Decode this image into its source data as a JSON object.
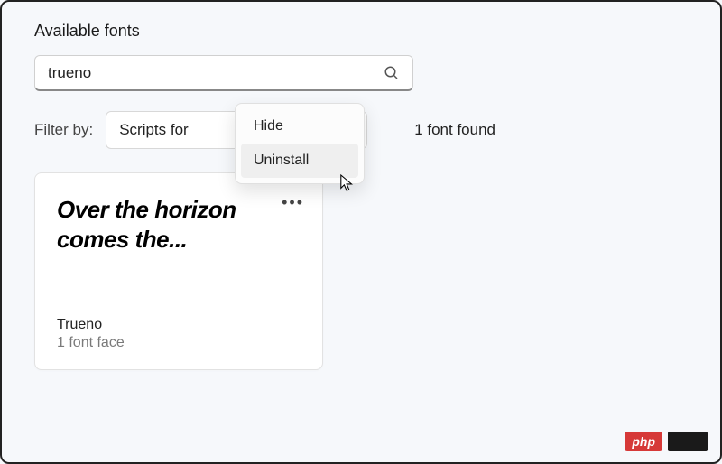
{
  "section_title": "Available fonts",
  "search": {
    "value": "trueno"
  },
  "filter": {
    "label": "Filter by:",
    "selected": "Scripts for"
  },
  "result_count": "1 font found",
  "font_card": {
    "preview": "Over the horizon comes the...",
    "name": "Trueno",
    "faces": "1 font face",
    "menu_dots": "•••"
  },
  "context_menu": {
    "items": [
      "Hide",
      "Uninstall"
    ]
  },
  "watermark": {
    "badge": "php"
  }
}
